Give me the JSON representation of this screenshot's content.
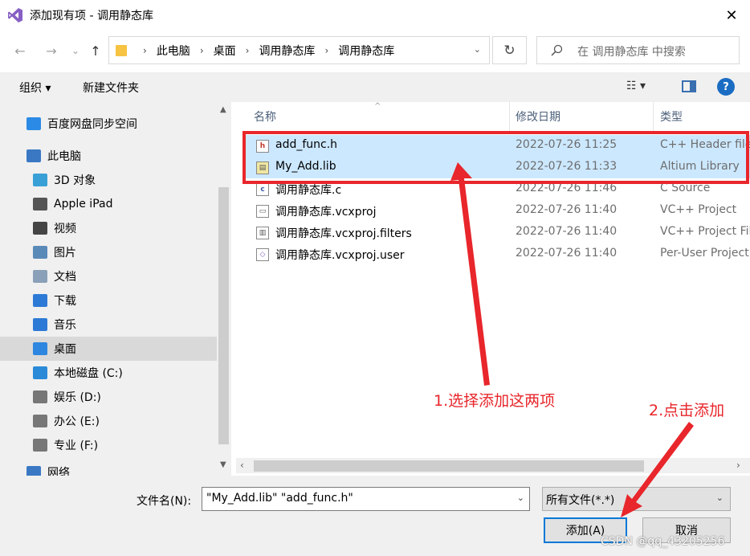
{
  "window": {
    "title": "添加现有项 - 调用静态库",
    "close_glyph": "✕"
  },
  "nav": {
    "back": "←",
    "forward": "→",
    "dropdown": "⌄",
    "up": "↑",
    "breadcrumbs": [
      "此电脑",
      "桌面",
      "调用静态库",
      "调用静态库"
    ],
    "crumb_sep": "›",
    "refresh": "↻",
    "search_placeholder": "在 调用静态库 中搜索"
  },
  "toolbar": {
    "organize": "组织 ▾",
    "new_folder": "新建文件夹",
    "view": "☷ ▾",
    "help": "?"
  },
  "sidebar": {
    "items": [
      {
        "label": "百度网盘同步空间",
        "icon": "cloud-sync-icon",
        "color": "#2b8ae6"
      },
      {
        "label": "此电脑",
        "icon": "computer-icon",
        "color": "#3a78c4"
      },
      {
        "label": "3D 对象",
        "icon": "cube-icon",
        "color": "#38a0d6"
      },
      {
        "label": "Apple iPad",
        "icon": "tablet-icon",
        "color": "#555555"
      },
      {
        "label": "视频",
        "icon": "video-icon",
        "color": "#444444"
      },
      {
        "label": "图片",
        "icon": "picture-icon",
        "color": "#5a8ab8"
      },
      {
        "label": "文档",
        "icon": "document-icon",
        "color": "#8aa0b8"
      },
      {
        "label": "下载",
        "icon": "download-icon",
        "color": "#2d7ad6"
      },
      {
        "label": "音乐",
        "icon": "music-icon",
        "color": "#2d7ad6"
      },
      {
        "label": "桌面",
        "icon": "desktop-icon",
        "color": "#2d86e0"
      },
      {
        "label": "本地磁盘 (C:)",
        "icon": "windows-drive-icon",
        "color": "#2a8ad8"
      },
      {
        "label": "娱乐 (D:)",
        "icon": "drive-icon",
        "color": "#777777"
      },
      {
        "label": "办公 (E:)",
        "icon": "drive-icon",
        "color": "#777777"
      },
      {
        "label": "专业 (F:)",
        "icon": "drive-icon",
        "color": "#777777"
      },
      {
        "label": "网络",
        "icon": "network-icon",
        "color": "#3a78c4"
      }
    ],
    "selected": "桌面"
  },
  "columns": {
    "name": "名称",
    "date": "修改日期",
    "type": "类型"
  },
  "files": [
    {
      "name": "add_func.h",
      "date": "2022-07-26 11:25",
      "type": "C++ Header file",
      "icon": "h-file-icon",
      "selected": true
    },
    {
      "name": "My_Add.lib",
      "date": "2022-07-26 11:33",
      "type": "Altium Library",
      "icon": "lib-file-icon",
      "selected": true
    },
    {
      "name": "调用静态库.c",
      "date": "2022-07-26 11:46",
      "type": "C Source",
      "icon": "c-file-icon",
      "selected": false
    },
    {
      "name": "调用静态库.vcxproj",
      "date": "2022-07-26 11:40",
      "type": "VC++ Project",
      "icon": "vcxproj-file-icon",
      "selected": false
    },
    {
      "name": "调用静态库.vcxproj.filters",
      "date": "2022-07-26 11:40",
      "type": "VC++ Project Filters",
      "icon": "filters-file-icon",
      "selected": false
    },
    {
      "name": "调用静态库.vcxproj.user",
      "date": "2022-07-26 11:40",
      "type": "Per-User Project",
      "icon": "user-file-icon",
      "selected": false
    }
  ],
  "bottom": {
    "filename_label": "文件名(N):",
    "filename_value": "\"My_Add.lib\" \"add_func.h\"",
    "filetype_value": "所有文件(*.*)",
    "add_button": "添加(A)",
    "cancel_button": "取消"
  },
  "annotations": {
    "step1": "1.选择添加这两项",
    "step2": "2.点击添加",
    "color": "#e8262b"
  },
  "watermark": "CSDN @qq_43205256",
  "colors": {
    "selection": "#cce8ff",
    "accent": "#0078d7",
    "panel": "#f0f0f0"
  }
}
